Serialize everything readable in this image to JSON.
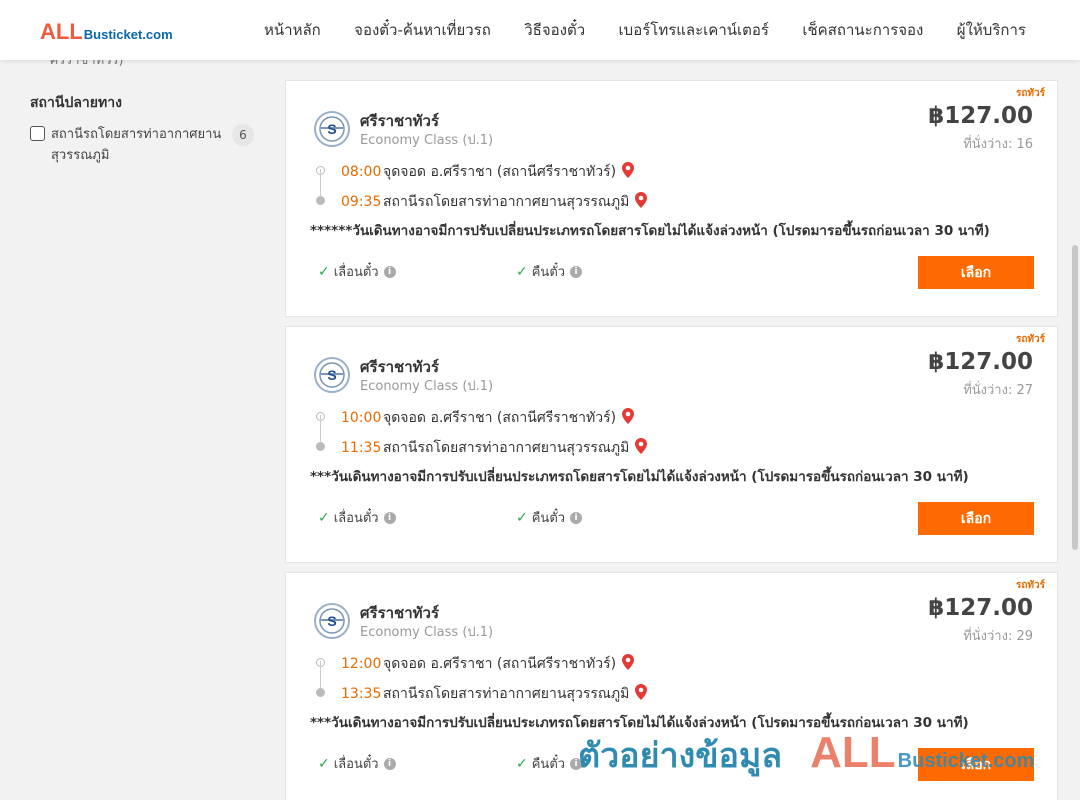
{
  "header": {
    "logo_all": "ALL",
    "logo_rest": "Busticket.com",
    "nav": [
      "หน้าหลัก",
      "จองตั๋ว-ค้นหาเที่ยวรถ",
      "วิธีจองตั๋ว",
      "เบอร์โทรและเคาน์เตอร์",
      "เช็คสถานะการจอง",
      "ผู้ให้บริการ"
    ]
  },
  "sidebar": {
    "cut_text": "ศรีราชาทัวร์)",
    "dest_title": "สถานีปลายทาง",
    "dest_option_label": "สถานีรถโดยสารท่าอากาศยานสุวรรณภูมิ",
    "dest_option_count": "6"
  },
  "trips": [
    {
      "badge": "รถทัวร์",
      "operator": "ศรีราชาทัวร์",
      "class": "Economy Class (ป.1)",
      "price": "฿127.00",
      "seats_label": "ที่นั่งว่าง: 16",
      "depart_time": "08:00",
      "depart_place": "จุดจอด อ.ศรีราชา (สถานีศรีราชาทัวร์)",
      "arrive_time": "09:35",
      "arrive_place": "สถานีรถโดยสารท่าอากาศยานสุวรรณภูมิ",
      "note": "******วันเดินทางอาจมีการปรับเปลี่ยนประเภทรถโดยสารโดยไม่ได้แจ้งล่วงหน้า (โปรดมารอขึ้นรถก่อนเวลา 30 นาที)",
      "feature_1": "เลื่อนตั๋ว",
      "feature_2": "คืนตั๋ว",
      "select_label": "เลือก"
    },
    {
      "badge": "รถทัวร์",
      "operator": "ศรีราชาทัวร์",
      "class": "Economy Class (ป.1)",
      "price": "฿127.00",
      "seats_label": "ที่นั่งว่าง: 27",
      "depart_time": "10:00",
      "depart_place": "จุดจอด อ.ศรีราชา (สถานีศรีราชาทัวร์)",
      "arrive_time": "11:35",
      "arrive_place": "สถานีรถโดยสารท่าอากาศยานสุวรรณภูมิ",
      "note": "***วันเดินทางอาจมีการปรับเปลี่ยนประเภทรถโดยสารโดยไม่ได้แจ้งล่วงหน้า (โปรดมารอขึ้นรถก่อนเวลา 30 นาที)",
      "feature_1": "เลื่อนตั๋ว",
      "feature_2": "คืนตั๋ว",
      "select_label": "เลือก"
    },
    {
      "badge": "รถทัวร์",
      "operator": "ศรีราชาทัวร์",
      "class": "Economy Class (ป.1)",
      "price": "฿127.00",
      "seats_label": "ที่นั่งว่าง: 29",
      "depart_time": "12:00",
      "depart_place": "จุดจอด อ.ศรีราชา (สถานีศรีราชาทัวร์)",
      "arrive_time": "13:35",
      "arrive_place": "สถานีรถโดยสารท่าอากาศยานสุวรรณภูมิ",
      "note": "***วันเดินทางอาจมีการปรับเปลี่ยนประเภทรถโดยสารโดยไม่ได้แจ้งล่วงหน้า (โปรดมารอขึ้นรถก่อนเวลา 30 นาที)",
      "feature_1": "เลื่อนตั๋ว",
      "feature_2": "คืนตั๋ว",
      "select_label": "เลือก"
    }
  ],
  "watermark": {
    "thai": "ตัวอย่างข้อมูล",
    "all": "ALL",
    "rest": "Busticket.com"
  },
  "colors": {
    "accent_orange": "#ff6a00",
    "time_orange": "#e86a00",
    "pin_red": "#e53935",
    "check_green": "#2ca84a",
    "logo_red": "#f05a3c",
    "logo_blue": "#0a67a8"
  },
  "icons": {
    "pin": "location-pin-icon",
    "check": "check-icon",
    "info": "info-icon",
    "operator_logo": "operator-logo-icon"
  }
}
